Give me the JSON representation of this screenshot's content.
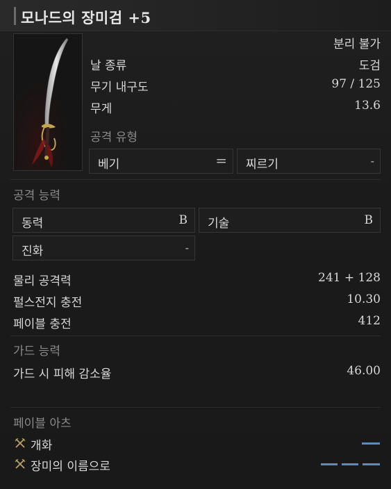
{
  "item": {
    "name": "모나드의 장미검",
    "upgrade": "+5"
  },
  "weapon_info": {
    "unique_note": "분리 불가",
    "type_label": "날 종류",
    "type_value": "도검",
    "durability_label": "무기 내구도",
    "durability_value": "97 / 125",
    "weight_label": "무게",
    "weight_value": "13.6"
  },
  "attack_type": {
    "heading": "공격 유형",
    "primary": "베기",
    "primary_sign": "=",
    "secondary": "찌르기",
    "secondary_value": "-"
  },
  "attack_ability": {
    "heading": "공격 능력",
    "power_label": "동력",
    "power_grade": "B",
    "skill_label": "기술",
    "skill_grade": "B",
    "evolution_label": "진화",
    "evolution_value": "-"
  },
  "stats": {
    "phys_label": "물리 공격력",
    "phys_value": "241 + 128",
    "pulse_label": "펄스전지 충전",
    "pulse_value": "10.30",
    "fable_label": "페이블 충전",
    "fable_value": "412"
  },
  "guard": {
    "heading": "가드 능력",
    "reduction_label": "가드 시 피해 감소율",
    "reduction_value": "46.00"
  },
  "fable_arts": {
    "heading": "페이블 아츠",
    "items": [
      {
        "label": "개화",
        "slots": 1
      },
      {
        "label": "장미의 이름으로",
        "slots": 3
      }
    ]
  },
  "colors": {
    "slot_bar": "#5b8cc4",
    "blood_accent": "#7a1a1a"
  }
}
